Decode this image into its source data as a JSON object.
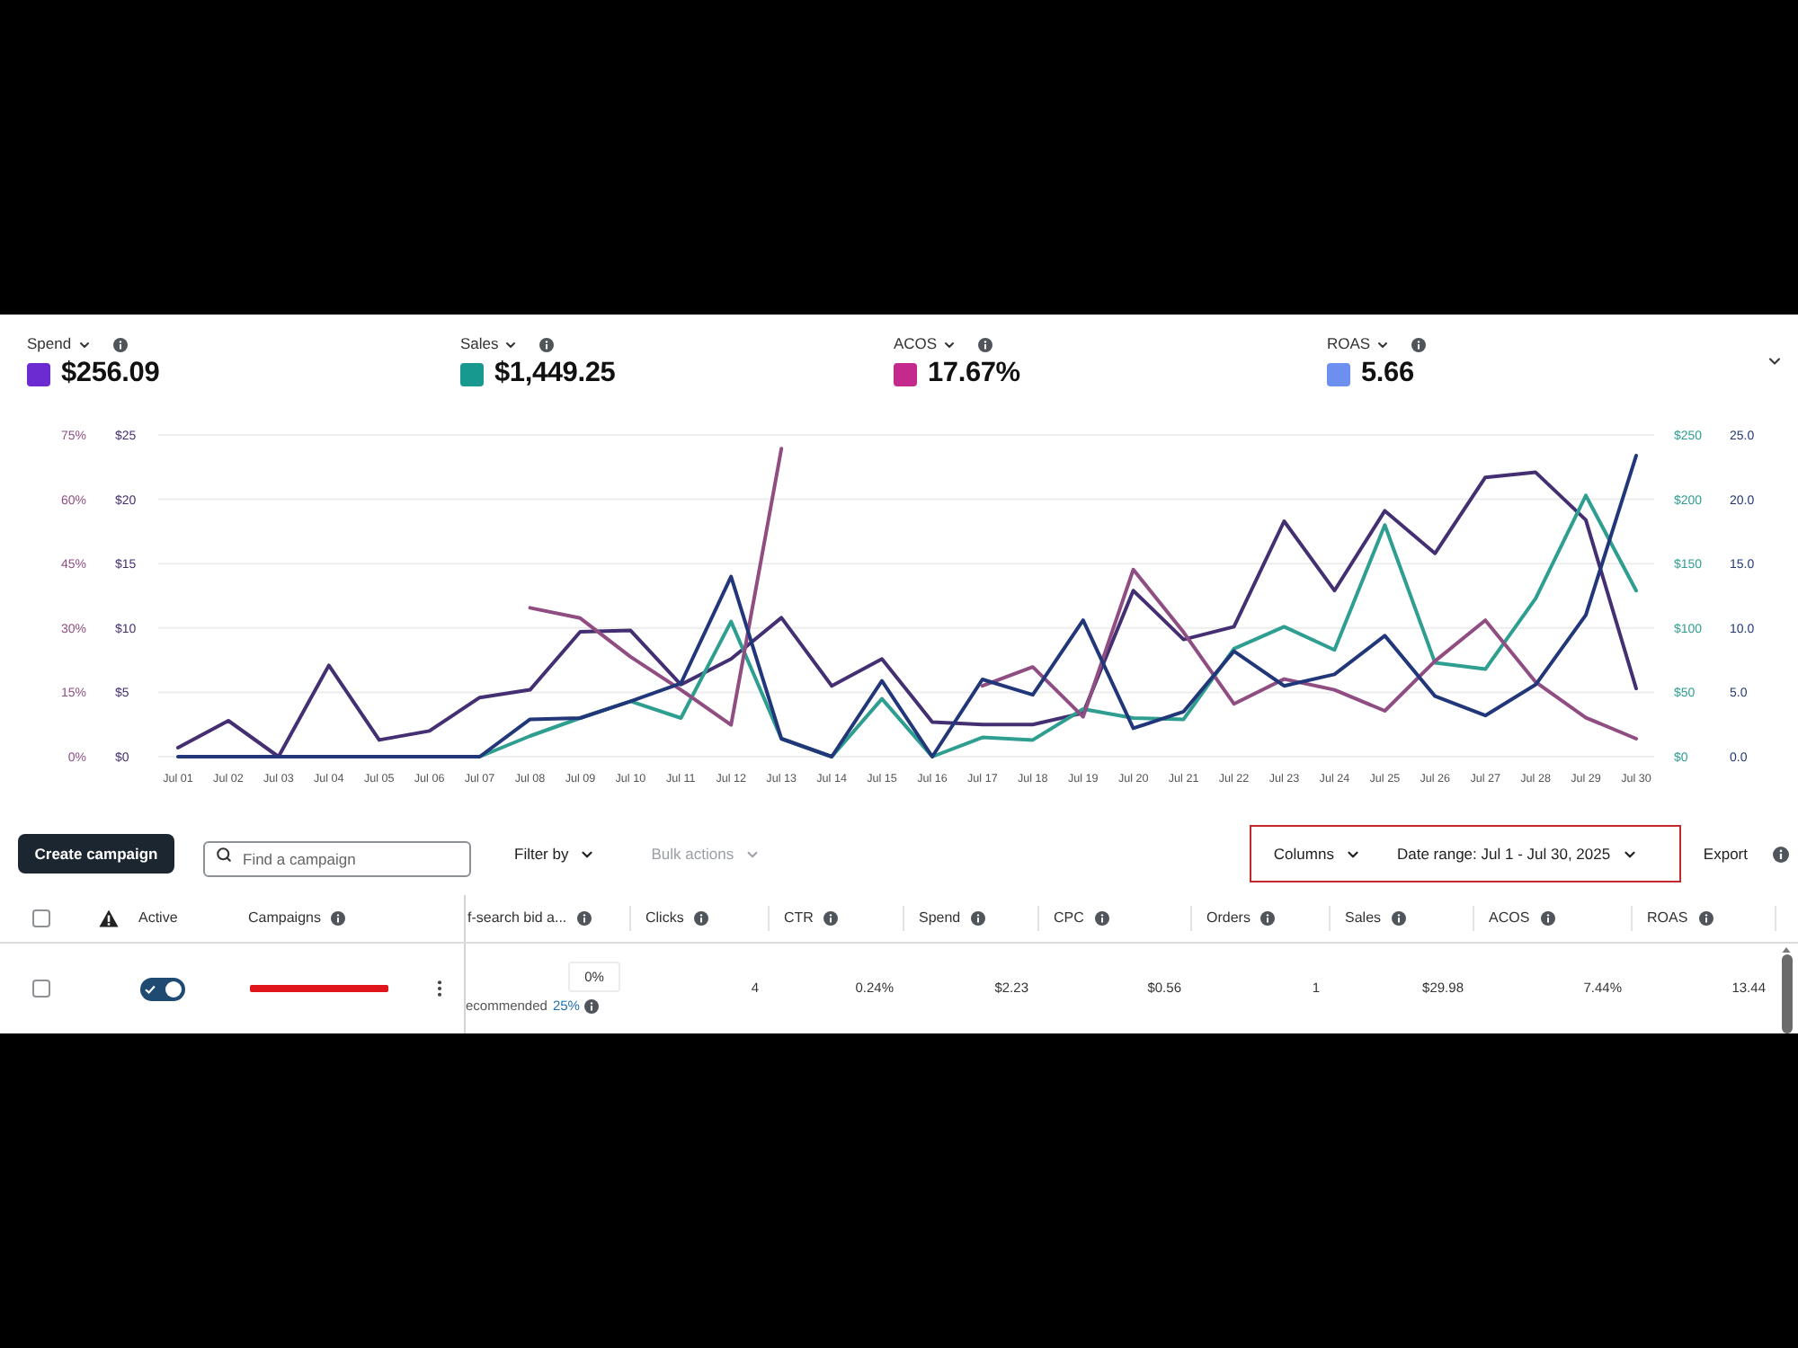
{
  "metrics": [
    {
      "value": "$256.09",
      "color": "#6b2bd0"
    },
    {
      "value": "$1,449.25",
      "color": "#17998f"
    },
    {
      "value": "17.67%",
      "color": "#c42a8c"
    },
    {
      "value": "5.66",
      "color": "#6d8ff0"
    }
  ],
  "chart_layers": [
    {
      "chart_data": {
        "type": "line",
        "grid": true,
        "categories": [
          "Jul 01",
          "Jul 02",
          "Jul 03",
          "Jul 04",
          "Jul 05",
          "Jul 06",
          "Jul 07",
          "Jul 08",
          "Jul 09",
          "Jul 10",
          "Jul 11",
          "Jul 12",
          "Jul 13",
          "Jul 14",
          "Jul 15",
          "Jul 16",
          "Jul 17",
          "Jul 18",
          "Jul 19",
          "Jul 20",
          "Jul 21",
          "Jul 22",
          "Jul 23",
          "Jul 24",
          "Jul 25",
          "Jul 26",
          "Jul 27",
          "Jul 28",
          "Jul 29",
          "Jul 30"
        ],
        "ylim": [
          0,
          25
        ],
        "yticks": [
          {
            "value": 0,
            "label": "$0"
          },
          {
            "value": 5,
            "label": "$5"
          },
          {
            "value": 10,
            "label": "$10"
          },
          {
            "value": 15,
            "label": "$15"
          },
          {
            "value": 20,
            "label": "$20"
          },
          {
            "value": 25,
            "label": "$25"
          }
        ],
        "y2lim": [
          0,
          250
        ],
        "y2ticks": [
          {
            "value": 0,
            "label": "$0"
          },
          {
            "value": 50,
            "label": "$50"
          },
          {
            "value": 100,
            "label": "$100"
          },
          {
            "value": 150,
            "label": "$150"
          },
          {
            "value": 200,
            "label": "$200"
          },
          {
            "value": 250,
            "label": "$250"
          }
        ],
        "series": [
          {
            "name": "Spend",
            "color": "#432f72",
            "values": [
              0.7,
              2.8,
              0,
              7.1,
              1.3,
              2.0,
              4.6,
              5.2,
              9.7,
              9.8,
              5.6,
              7.6,
              10.8,
              5.5,
              7.6,
              2.7,
              2.5,
              2.5,
              3.4,
              12.9,
              9.1,
              10.1,
              18.3,
              12.9,
              19.1,
              15.8,
              21.7,
              22.1,
              18.4,
              5.3
            ]
          },
          {
            "name": "Sales",
            "color": "#2e9e90",
            "axis": "y2",
            "values": [
              null,
              null,
              null,
              null,
              null,
              0,
              0,
              16,
              30,
              43,
              30,
              105,
              14,
              0,
              45,
              0,
              15,
              13,
              37,
              30,
              29,
              84,
              101,
              83,
              180,
              73,
              68,
              123,
              203,
              129
            ]
          }
        ]
      }
    },
    {
      "chart_data": {
        "type": "line",
        "ylim": [
          0,
          75
        ],
        "yticks": [
          {
            "value": 0,
            "label": "0%"
          },
          {
            "value": 15,
            "label": "15%"
          },
          {
            "value": 30,
            "label": "30%"
          },
          {
            "value": 45,
            "label": "45%"
          },
          {
            "value": 60,
            "label": "60%"
          },
          {
            "value": 75,
            "label": "75%"
          }
        ],
        "y2lim": [
          0,
          25
        ],
        "y2ticks": [
          {
            "value": 0,
            "label": "0.0"
          },
          {
            "value": 5,
            "label": "5.0"
          },
          {
            "value": 10,
            "label": "10.0"
          },
          {
            "value": 15,
            "label": "15.0"
          },
          {
            "value": 20,
            "label": "20.0"
          },
          {
            "value": 25,
            "label": "25.0"
          }
        ],
        "series": [
          {
            "name": "ACOS",
            "color": "#8f4d82",
            "values": [
              null,
              null,
              null,
              null,
              null,
              null,
              null,
              34.7,
              32.3,
              23.3,
              15.6,
              7.4,
              71.8,
              null,
              null,
              null,
              16.5,
              20.9,
              9.3,
              43.6,
              29,
              12.3,
              18.1,
              15.6,
              10.7,
              22.3,
              31.8,
              17.4,
              9.1,
              4.2
            ]
          },
          {
            "name": "ROAS",
            "color": "#22377a",
            "axis": "y2",
            "values": [
              0,
              0,
              0,
              0,
              0,
              0,
              0,
              2.9,
              3.0,
              4.3,
              5.7,
              14.0,
              1.4,
              0,
              5.9,
              0,
              6.0,
              4.8,
              10.6,
              2.2,
              3.5,
              8.2,
              5.5,
              6.4,
              9.4,
              4.7,
              3.2,
              5.6,
              11.0,
              23.4
            ]
          }
        ]
      }
    }
  ],
  "toolbar": {
    "create_button": "Create campaign",
    "search": {
      "placeholder": "Find a campaign"
    },
    "filter_button": "Filter by",
    "bulk_actions": {
      "label": "Bulk actions",
      "disabled": true
    },
    "columns_button": "Columns",
    "date_range_button": "Date range: Jul 1 - Jul 30, 2025",
    "export_button": "Export"
  },
  "table": {
    "all_selected": false,
    "columns": [
      {
        "label": "Active",
        "info": false
      },
      {
        "label": "Campaigns",
        "info": true
      },
      {
        "label": "f-search bid a...",
        "info": true
      },
      {
        "label": "Clicks",
        "info": true
      },
      {
        "label": "CTR",
        "info": true
      },
      {
        "label": "Spend",
        "info": true
      },
      {
        "label": "CPC",
        "info": true
      },
      {
        "label": "Orders",
        "info": true
      },
      {
        "label": "Sales",
        "info": true
      },
      {
        "label": "ACOS",
        "info": true
      },
      {
        "label": "ROAS",
        "info": true
      }
    ],
    "rows": [
      {
        "selected": false,
        "active": true,
        "bid": "0%",
        "recommended_label": "ecommended",
        "recommended_value": "25%",
        "cells": [
          "4",
          "0.24%",
          "$2.23",
          "$0.56",
          "1",
          "$29.98",
          "7.44%",
          "13.44"
        ]
      }
    ]
  }
}
